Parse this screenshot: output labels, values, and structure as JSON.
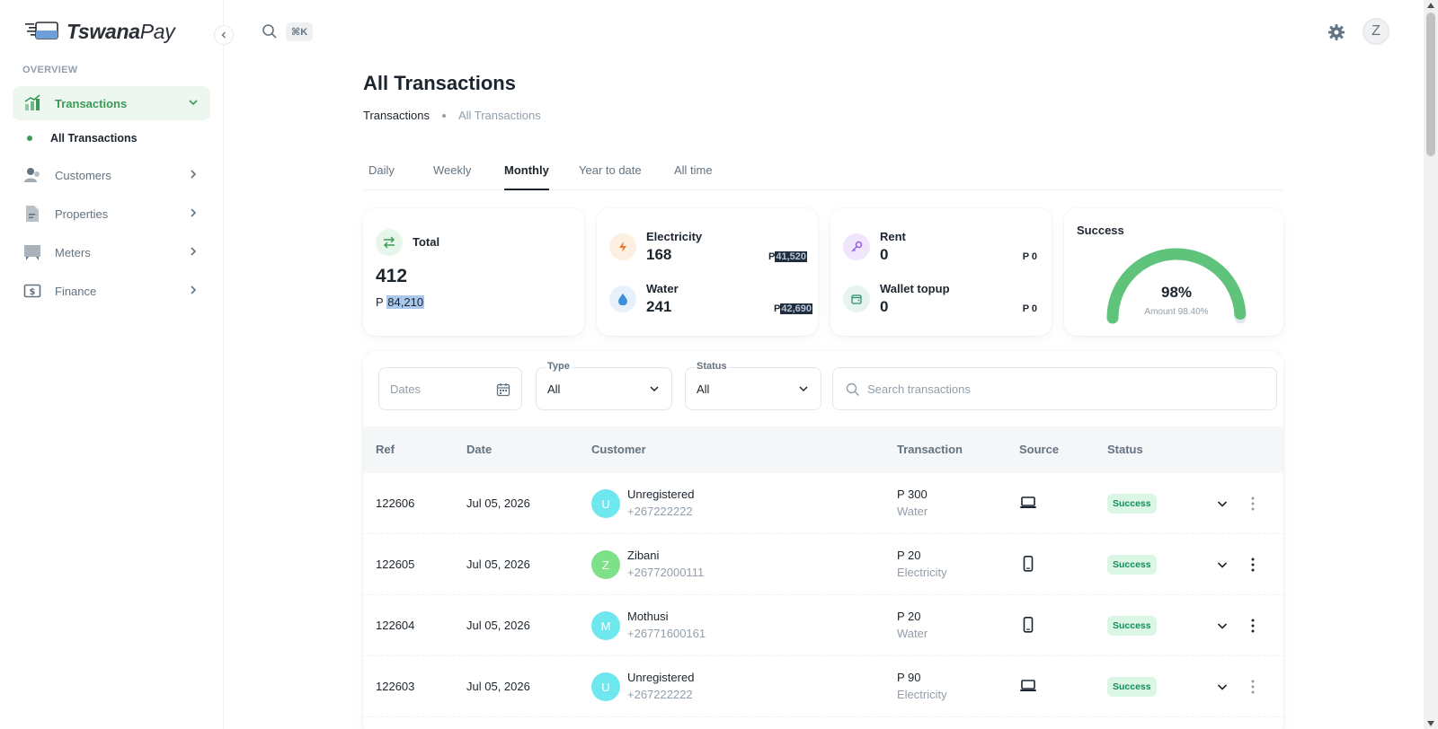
{
  "app": {
    "logo_bold": "Tswana",
    "logo_light": "Pay"
  },
  "sidebar": {
    "section": "OVERVIEW",
    "items": [
      {
        "label": "Transactions",
        "icon": "chart-icon",
        "active": true
      },
      {
        "label": "Customers",
        "icon": "users-icon"
      },
      {
        "label": "Properties",
        "icon": "document-icon"
      },
      {
        "label": "Meters",
        "icon": "meter-icon"
      },
      {
        "label": "Finance",
        "icon": "dollar-icon"
      }
    ],
    "sub_item": "All Transactions"
  },
  "topbar": {
    "shortcut": "⌘K",
    "user_initial": "Z"
  },
  "page": {
    "title": "All Transactions",
    "breadcrumb": [
      "Transactions",
      "All Transactions"
    ]
  },
  "tabs": [
    "Daily",
    "Weekly",
    "Monthly",
    "Year to date",
    "All time"
  ],
  "active_tab": "Monthly",
  "stats": {
    "total": {
      "label": "Total",
      "count": "412",
      "currency": "P",
      "amount": "84,210"
    },
    "electricity": {
      "label": "Electricity",
      "count": "168",
      "currency": "P",
      "amount": "41,520"
    },
    "water": {
      "label": "Water",
      "count": "241",
      "currency": "P",
      "amount": "42,690"
    },
    "rent": {
      "label": "Rent",
      "count": "0",
      "amount": "P 0"
    },
    "wallet": {
      "label": "Wallet topup",
      "count": "0",
      "amount": "P 0"
    },
    "success": {
      "label": "Success",
      "percent_text": "98%",
      "percent": 98,
      "sub": "Amount 98.40%"
    }
  },
  "filters": {
    "dates_placeholder": "Dates",
    "type_label": "Type",
    "type_value": "All",
    "status_label": "Status",
    "status_value": "All",
    "search_placeholder": "Search transactions"
  },
  "table": {
    "headers": [
      "Ref",
      "Date",
      "Customer",
      "Transaction",
      "Source",
      "Status"
    ],
    "rows": [
      {
        "ref": "122606",
        "date": "Jul 05, 2026",
        "initial": "U",
        "name": "Unregistered",
        "phone": "+267222222",
        "amount": "P 300",
        "type": "Water",
        "source": "laptop",
        "status": "Success"
      },
      {
        "ref": "122605",
        "date": "Jul 05, 2026",
        "initial": "Z",
        "name": "Zibani",
        "phone": "+26772000111",
        "amount": "P 20",
        "type": "Electricity",
        "source": "mobile",
        "status": "Success"
      },
      {
        "ref": "122604",
        "date": "Jul 05, 2026",
        "initial": "M",
        "name": "Mothusi",
        "phone": "+26771600161",
        "amount": "P 20",
        "type": "Water",
        "source": "mobile",
        "status": "Success"
      },
      {
        "ref": "122603",
        "date": "Jul 05, 2026",
        "initial": "U",
        "name": "Unregistered",
        "phone": "+267222222",
        "amount": "P 90",
        "type": "Electricity",
        "source": "laptop",
        "status": "Success"
      }
    ]
  },
  "colors": {
    "accent": "#3a9a55",
    "gauge": "#5fc37c",
    "avatar_cyan": "#6ee7ef",
    "avatar_green": "#7fe08a"
  }
}
